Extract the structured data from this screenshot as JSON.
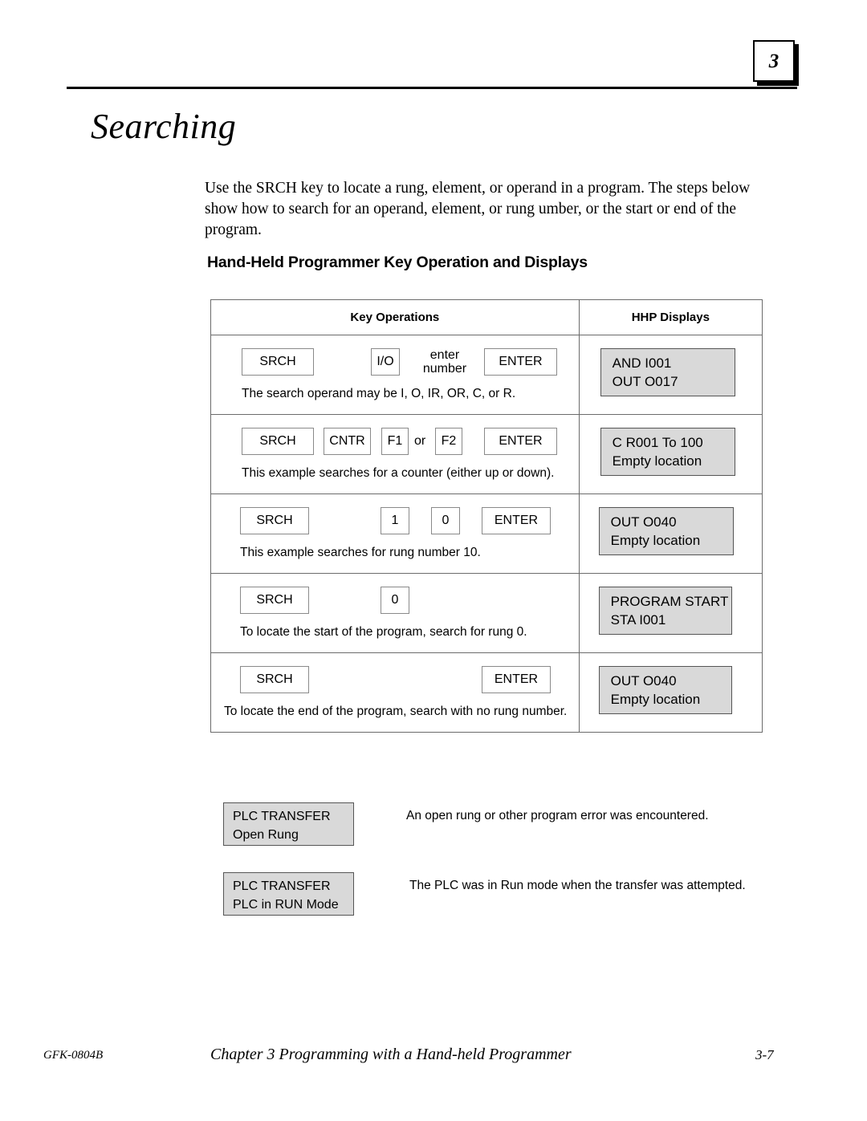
{
  "header": {
    "chapter_badge": "3"
  },
  "title": "Searching",
  "intro_paragraph": "Use the SRCH key to locate a rung, element, or operand in a program.  The steps below show how to search for an operand, element, or rung umber, or the start or end of the program.",
  "section_heading": "Hand-Held Programmer Key Operation and Displays",
  "table": {
    "columns": [
      "Key Operations",
      "HHP Displays"
    ],
    "rows": [
      {
        "keys": [
          {
            "type": "key",
            "label": "SRCH"
          },
          {
            "type": "key",
            "label": "I/O"
          },
          {
            "type": "text",
            "label": "enter\nnumber"
          },
          {
            "type": "key",
            "label": "ENTER"
          }
        ],
        "caption": "The search operand may be I, O, IR, OR, C, or R.",
        "display": [
          "AND  I001",
          "OUT  O017"
        ]
      },
      {
        "keys": [
          {
            "type": "key",
            "label": "SRCH"
          },
          {
            "type": "key",
            "label": "CNTR"
          },
          {
            "type": "key",
            "label": "F1"
          },
          {
            "type": "text",
            "label": "or"
          },
          {
            "type": "key",
            "label": "F2"
          },
          {
            "type": "key",
            "label": "ENTER"
          }
        ],
        "caption": "This example searches for a counter (either up or down).",
        "display": [
          "C  R001 To 100",
          "Empty location"
        ]
      },
      {
        "keys": [
          {
            "type": "key",
            "label": "SRCH"
          },
          {
            "type": "key",
            "label": "1"
          },
          {
            "type": "key",
            "label": "0"
          },
          {
            "type": "key",
            "label": "ENTER"
          }
        ],
        "caption": "This example searches for rung number 10.",
        "display": [
          "OUT  O040",
          "Empty location"
        ]
      },
      {
        "keys": [
          {
            "type": "key",
            "label": "SRCH"
          },
          {
            "type": "key",
            "label": "0"
          }
        ],
        "caption": "To locate the start of the program, search for rung 0.",
        "display": [
          "PROGRAM START",
          "STA  I001"
        ]
      },
      {
        "keys": [
          {
            "type": "key",
            "label": "SRCH"
          },
          {
            "type": "key",
            "label": "ENTER"
          }
        ],
        "caption": "To locate the end of the program, search with no rung number.",
        "display": [
          "OUT  O040",
          "Empty location"
        ]
      }
    ]
  },
  "messages": [
    {
      "display_line1": "PLC TRANSFER",
      "display_line2": "Open Rung",
      "description": "An open rung or other program error was encountered."
    },
    {
      "display_line1": "PLC TRANSFER",
      "display_line2": "PLC in RUN Mode",
      "description": "The PLC was in Run mode when the transfer was attempted."
    }
  ],
  "footer": {
    "doc_id": "GFK-0804B",
    "center": "Chapter 3  Programming with a Hand-held Programmer",
    "page": "3-7"
  },
  "colors": {
    "display_fill": "#d9d9d9",
    "rule": "#000000",
    "table_border": "#6b6b6b"
  }
}
